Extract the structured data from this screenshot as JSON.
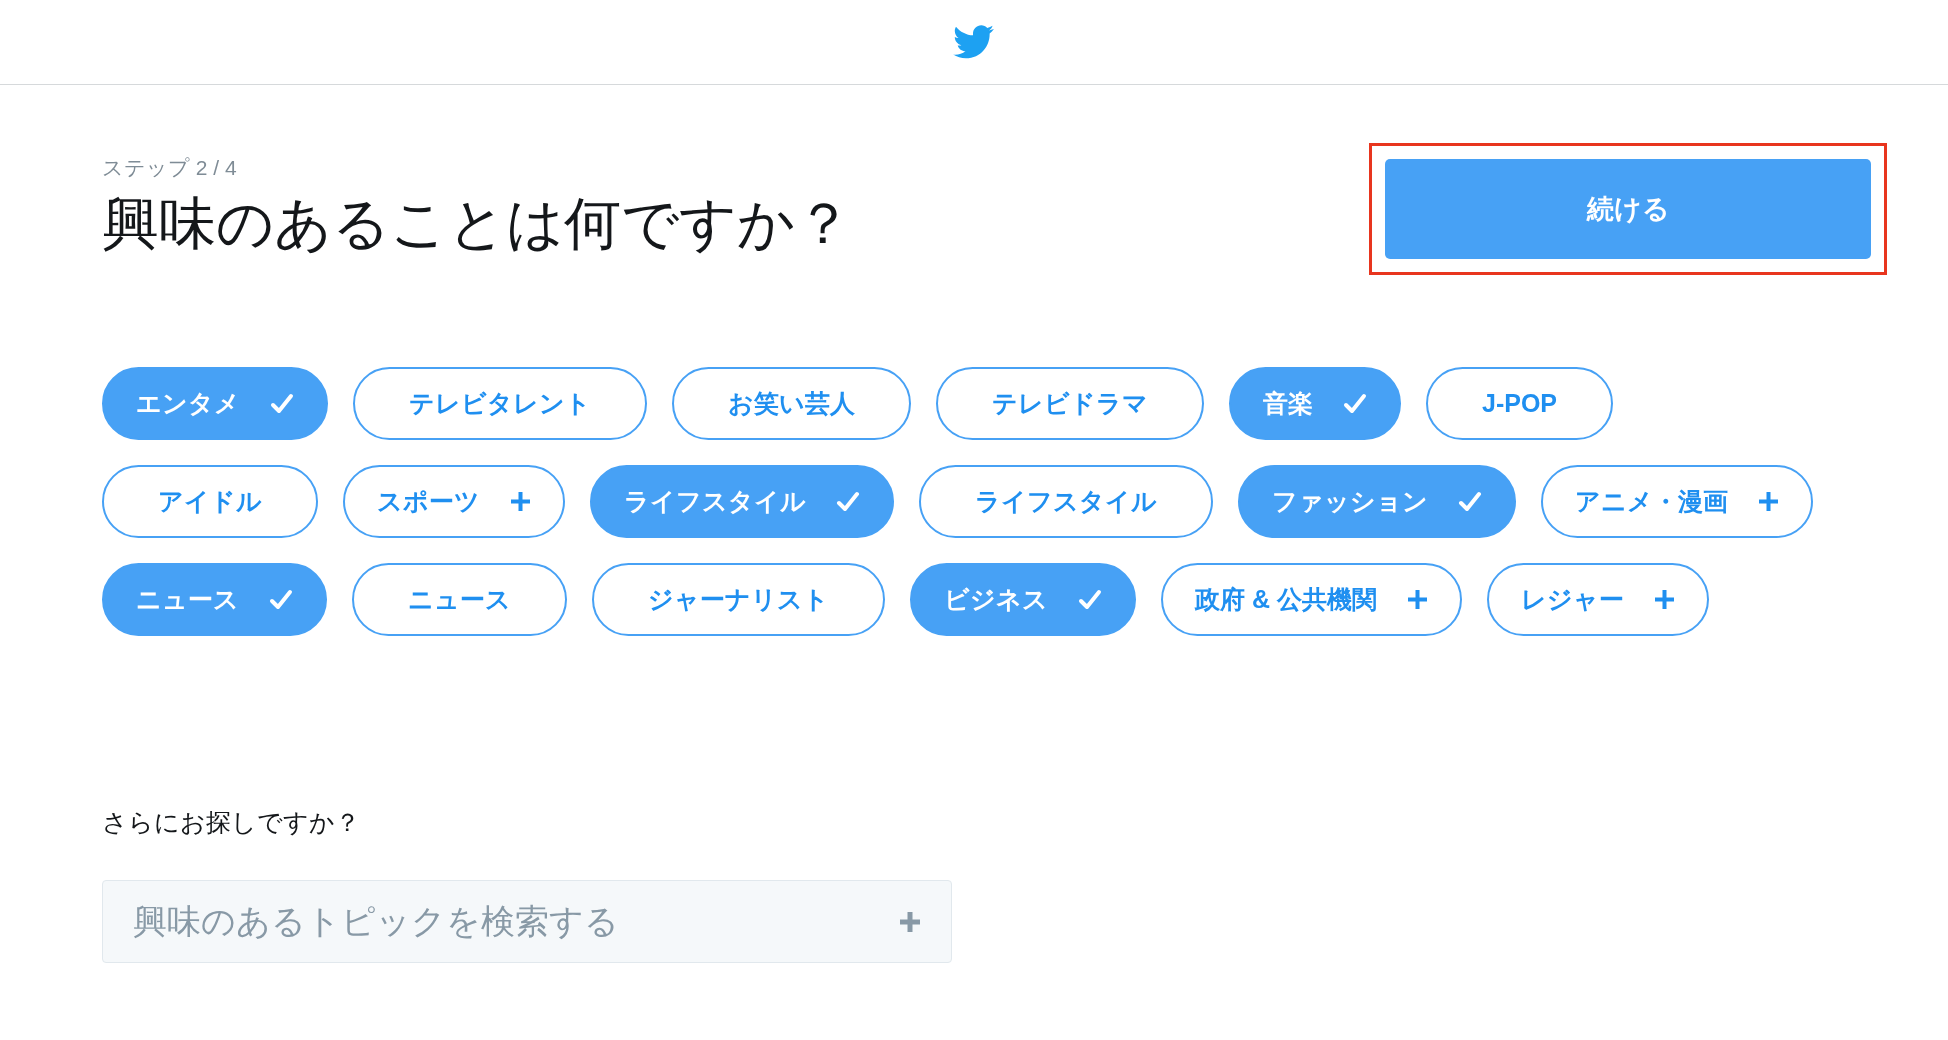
{
  "step": "ステップ 2 / 4",
  "title": "興味のあることは何ですか？",
  "continue_button": {
    "label": "続ける",
    "highlighted": true
  },
  "chip_rows": [
    [
      {
        "label": "エンタメ",
        "selected": true
      },
      {
        "label": "テレビタレント",
        "selected": false,
        "expandable": false
      },
      {
        "label": "お笑い芸人",
        "selected": false,
        "expandable": false
      },
      {
        "label": "テレビドラマ",
        "selected": false,
        "expandable": false
      },
      {
        "label": "音楽",
        "selected": true
      },
      {
        "label": "J-POP",
        "selected": false,
        "expandable": false
      }
    ],
    [
      {
        "label": "アイドル",
        "selected": false,
        "expandable": false
      },
      {
        "label": "スポーツ",
        "selected": false,
        "expandable": true
      },
      {
        "label": "ライフスタイル",
        "selected": true
      },
      {
        "label": "ライフスタイル",
        "selected": false,
        "expandable": false
      },
      {
        "label": "ファッション",
        "selected": true
      },
      {
        "label": "アニメ・漫画",
        "selected": false,
        "expandable": true
      }
    ],
    [
      {
        "label": "ニュース",
        "selected": true
      },
      {
        "label": "ニュース",
        "selected": false,
        "expandable": false
      },
      {
        "label": "ジャーナリスト",
        "selected": false,
        "expandable": false
      },
      {
        "label": "ビジネス",
        "selected": true
      },
      {
        "label": "政府 & 公共機関",
        "selected": false,
        "expandable": true
      },
      {
        "label": "レジャー",
        "selected": false,
        "expandable": true
      }
    ]
  ],
  "more_prompt": "さらにお探しですか？",
  "search": {
    "placeholder": "興味のあるトピックを検索する"
  }
}
